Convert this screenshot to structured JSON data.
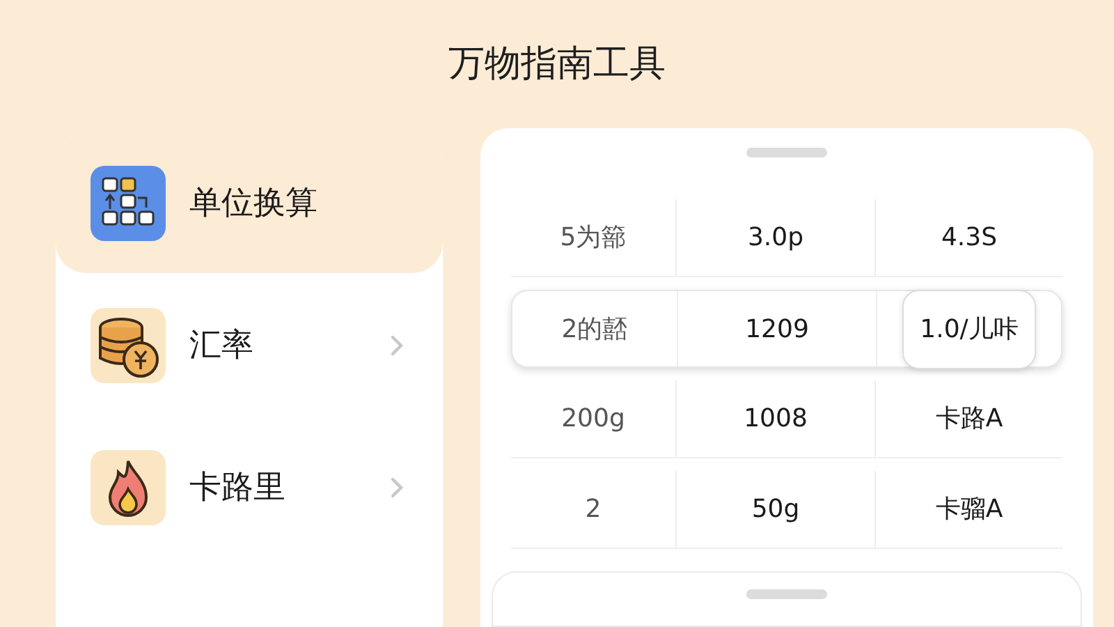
{
  "title": "万物指南工具",
  "sidebar": {
    "items": [
      {
        "label": "单位换算",
        "kind": "units",
        "selected": true
      },
      {
        "label": "汇率",
        "kind": "coins",
        "selected": false
      },
      {
        "label": "卡路里",
        "kind": "flame",
        "selected": false
      }
    ]
  },
  "table": {
    "rows": [
      {
        "selected": false,
        "cells": [
          {
            "text": "5为篰",
            "selected": false
          },
          {
            "text": "3.0p",
            "selected": false
          },
          {
            "text": "4.3S",
            "selected": false
          }
        ]
      },
      {
        "selected": true,
        "cells": [
          {
            "text": "2的嚭",
            "selected": false
          },
          {
            "text": "1209",
            "selected": false
          },
          {
            "text": "1.0/儿咔",
            "selected": true
          }
        ]
      },
      {
        "selected": false,
        "cells": [
          {
            "text": "200g",
            "selected": false
          },
          {
            "text": "1008",
            "selected": false
          },
          {
            "text": "卡路A",
            "selected": false
          }
        ]
      },
      {
        "selected": false,
        "cells": [
          {
            "text": "2",
            "selected": false
          },
          {
            "text": "50g",
            "selected": false
          },
          {
            "text": "卡骝A",
            "selected": false
          }
        ]
      }
    ]
  }
}
